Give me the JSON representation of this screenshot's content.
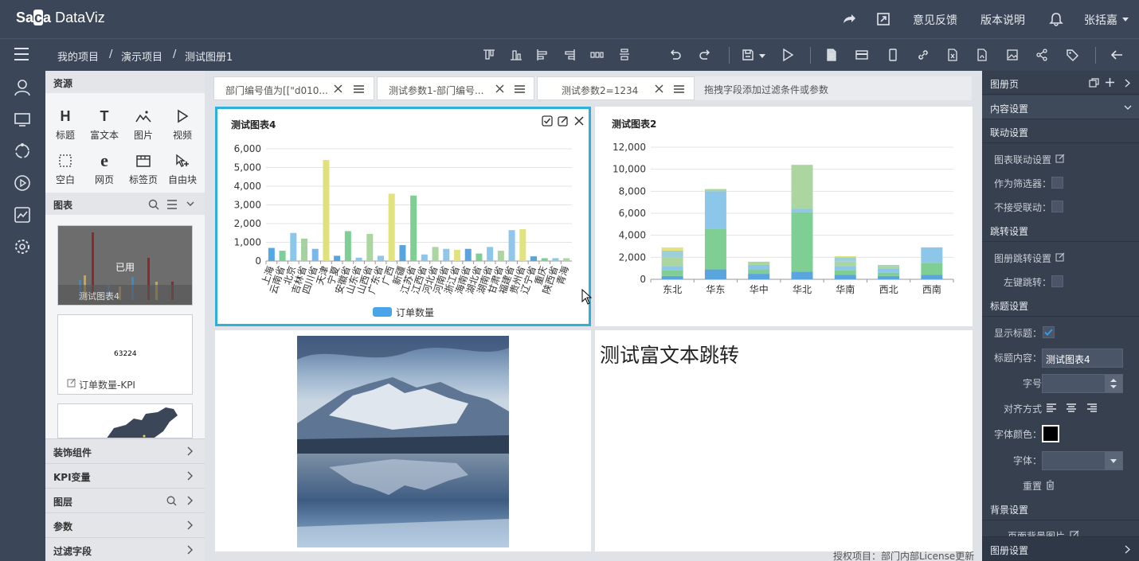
{
  "app": {
    "logo_a": "Sa",
    "logo_b": "a",
    "logo_c": " DataViz"
  },
  "topbar": {
    "feedback": "意见反馈",
    "version": "版本说明",
    "user": "张括嘉"
  },
  "breadcrumb": {
    "root": "我的项目",
    "sep1": "/",
    "project": "演示项目",
    "sep2": "/",
    "book": "测试图册1"
  },
  "resources": {
    "title": "资源",
    "items": [
      {
        "icon": "H",
        "label": "标题"
      },
      {
        "icon": "T",
        "label": "富文本"
      },
      {
        "icon": "img",
        "label": "图片"
      },
      {
        "icon": "play",
        "label": "视频"
      },
      {
        "icon": "blank",
        "label": "空白"
      },
      {
        "icon": "e",
        "label": "网页"
      },
      {
        "icon": "tab",
        "label": "标签页"
      },
      {
        "icon": "free",
        "label": "自由块"
      }
    ],
    "charts_title": "图表",
    "thumb1_caption": "测试图表4",
    "thumb1_overlay": "已用",
    "thumb2_value": "63224",
    "thumb2_caption": "订单数量-KPI",
    "accordions": [
      "装饰组件",
      "KPI变量",
      "图层",
      "参数",
      "过滤字段"
    ]
  },
  "filters": {
    "f1": "部门编号值为[[\"d010...",
    "f2": "测试参数1-部门编号...",
    "f3": "测试参数2=1234",
    "hint": "拖拽字段添加过滤条件或参数"
  },
  "chart4": {
    "title": "测试图表4",
    "legend": "订单数量"
  },
  "chart2": {
    "title": "测试图表2"
  },
  "richtext": {
    "text": "测试富文本跳转"
  },
  "footer": {
    "license": "授权项目：部门内部License更新"
  },
  "right_panel": {
    "page": "图册页",
    "content_settings": "内容设置",
    "linkage": "联动设置",
    "chart_linkage": "图表联动设置",
    "as_filter": "作为筛选器：",
    "no_linkage": "不接受联动：",
    "jump": "跳转设置",
    "chart_jump": "图册跳转设置",
    "left_jump": "左键跳转：",
    "title_settings": "标题设置",
    "show_title": "显示标题：",
    "title_content": "标题内容：",
    "title_value": "测试图表4",
    "font_size": "字号",
    "align": "对齐方式",
    "font_color": "字体颜色：",
    "font": "字体：",
    "reset": "重置",
    "bg_settings": "背景设置",
    "page_bg": "页面背景图片",
    "book_settings": "图册设置"
  },
  "chart_data": [
    {
      "type": "bar",
      "title": "测试图表4",
      "ylim": [
        0,
        6000
      ],
      "yticks": [
        "0",
        "1,000",
        "2,000",
        "3,000",
        "4,000",
        "5,000",
        "6,000"
      ],
      "categories": [
        "上海",
        "云南省",
        "北京",
        "吉林省",
        "四川省",
        "天津",
        "宁夏",
        "安徽省",
        "山东省",
        "山西省",
        "广东省",
        "广西",
        "新疆",
        "江苏省",
        "江西省",
        "河北省",
        "河南省",
        "浙江省",
        "海南省",
        "湖北省",
        "湖南省",
        "甘肃省",
        "福建省",
        "贵州省",
        "辽宁省",
        "重庆",
        "陕西省",
        "青海"
      ],
      "series": [
        {
          "name": "订单数量",
          "values": [
            700,
            550,
            1500,
            1200,
            650,
            5400,
            280,
            1600,
            180,
            1450,
            280,
            3600,
            850,
            3500,
            350,
            750,
            650,
            600,
            650,
            400,
            750,
            550,
            1650,
            1700,
            250,
            150,
            150,
            150
          ]
        }
      ],
      "colors": [
        "#55a8e4",
        "#7ccf9b",
        "#89c8ea",
        "#a5d2a0",
        "#79b8e8",
        "#dfe27a",
        "#5aa4de",
        "#7fcf95",
        "#8cc7ea",
        "#abd6a0",
        "#8fc6ea",
        "#e1e47e",
        "#5aa4de",
        "#7fcf95",
        "#8cc7ea",
        "#abd6a0",
        "#8fc6ea",
        "#e1e47e",
        "#5aa4de",
        "#7fcf95",
        "#8cc7ea",
        "#abd6a0",
        "#8fc6ea",
        "#e1e47e",
        "#5aa4de",
        "#7fcf95",
        "#8cc7ea",
        "#abd6a0"
      ],
      "legend_position": "bottom"
    },
    {
      "type": "bar",
      "stacked": true,
      "title": "测试图表2",
      "ylim": [
        0,
        12000
      ],
      "yticks": [
        "0",
        "2,000",
        "4,000",
        "6,000",
        "8,000",
        "10,000",
        "12,000"
      ],
      "categories": [
        "东北",
        "华东",
        "华中",
        "华北",
        "华南",
        "西北",
        "西南"
      ],
      "stacks": [
        [
          300,
          500,
          400,
          800,
          600,
          300
        ],
        [
          900,
          3700,
          3400,
          200
        ],
        [
          500,
          400,
          400,
          300
        ],
        [
          700,
          5400,
          300,
          4000
        ],
        [
          400,
          400,
          400,
          400,
          400,
          100
        ],
        [
          300,
          300,
          400,
          200,
          100
        ],
        [
          400,
          1100,
          1400
        ]
      ],
      "colors": [
        "#5aa5dd",
        "#7fcf95",
        "#8cc7ea",
        "#abd6a0",
        "#9ccfd8",
        "#e1e47e"
      ]
    }
  ]
}
